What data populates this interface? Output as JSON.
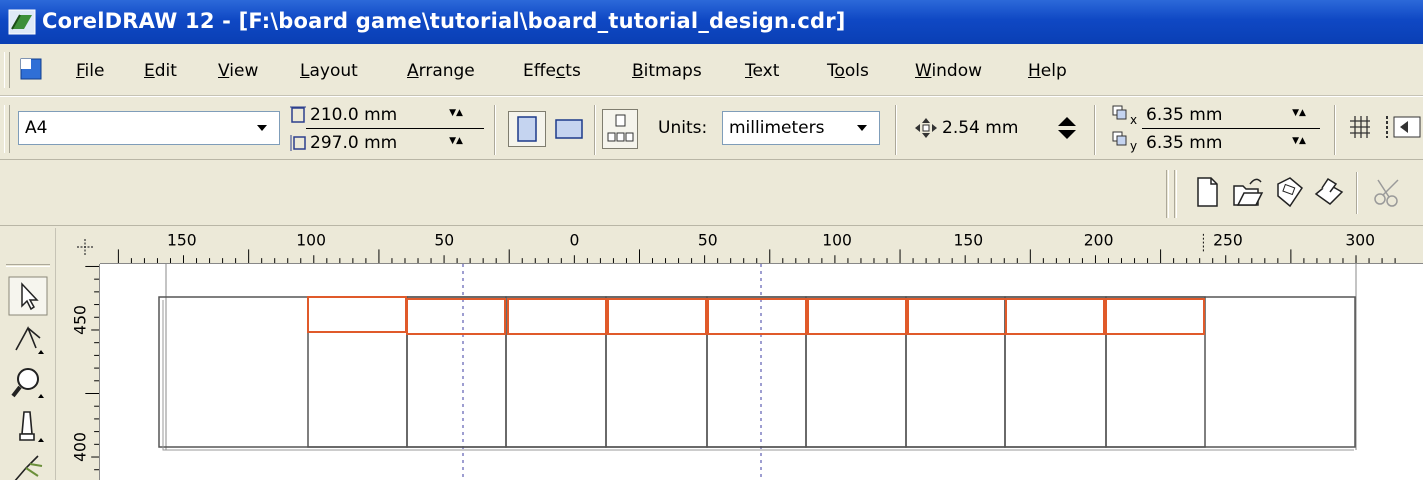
{
  "window": {
    "title": "CorelDRAW 12 - [F:\\board game\\tutorial\\board_tutorial_design.cdr]"
  },
  "menu": [
    {
      "label": "File"
    },
    {
      "label": "Edit"
    },
    {
      "label": "View"
    },
    {
      "label": "Layout"
    },
    {
      "label": "Arrange"
    },
    {
      "label": "Effects"
    },
    {
      "label": "Bitmaps"
    },
    {
      "label": "Text"
    },
    {
      "label": "Tools"
    },
    {
      "label": "Window"
    },
    {
      "label": "Help"
    }
  ],
  "property_bar": {
    "paper_size": "A4",
    "page_width": "210.0 mm",
    "page_height": "297.0 mm",
    "units_label": "Units:",
    "units_value": "millimeters",
    "nudge": "2.54 mm",
    "duplicate_x": "6.35 mm",
    "duplicate_y": "6.35 mm"
  },
  "rulers": {
    "horizontal_labels": [
      "150",
      "100",
      "50",
      "0",
      "50",
      "100",
      "150",
      "200",
      "250",
      "300"
    ],
    "vertical_labels": [
      "450",
      "400"
    ]
  },
  "standard_toolbar": {
    "icons": [
      "new-icon",
      "open-icon",
      "save-icon",
      "print-icon",
      "cut-icon"
    ]
  },
  "toolbox": {
    "tools": [
      "pick-tool-icon",
      "shape-tool-icon",
      "zoom-tool-icon",
      "freehand-tool-icon",
      "smart-fill-tool-icon"
    ]
  },
  "colors": {
    "title_bar": "#0a3fb4",
    "chrome": "#ece9d8",
    "board_outline": "#555555",
    "selection": "#e05a2a",
    "guide": "#6a6ab8"
  }
}
